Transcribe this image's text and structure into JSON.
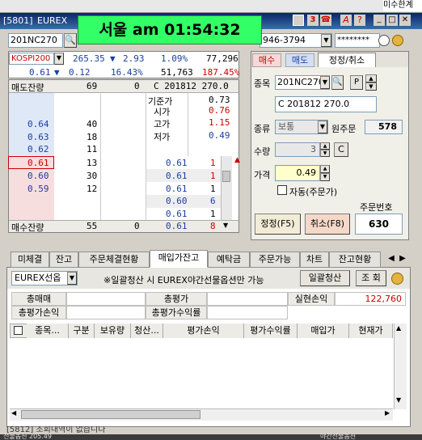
{
  "window": {
    "title_code": "[5801]",
    "title_text": "EUREX",
    "clock": "서울 am 01:54:32",
    "corner_label": "미수한계"
  },
  "left": {
    "code_value": "201NC270",
    "index_name": "KOSPI200",
    "index_price": "265.35",
    "index_change_arrow": "▼",
    "index_change": "2.93",
    "index_pct": "1.09%",
    "index_volume": "77,296",
    "row2_price": "0.61",
    "row2_arrow": "▼",
    "row2_change": "0.12",
    "row2_pct": "16.43%",
    "row2_volume": "51,763",
    "row2_ratio": "187.45%",
    "header_sell_label": "매도잔량",
    "header_sell_qty": "69",
    "header_zero": "0",
    "header_contract": "C 201812 270.0",
    "info": [
      {
        "label": "기준가",
        "value": "0.73"
      },
      {
        "label": "시가",
        "value": "0.76"
      },
      {
        "label": "고가",
        "value": "1.15"
      },
      {
        "label": "저가",
        "value": "0.49"
      }
    ],
    "asks": [
      {
        "price": "0.64",
        "qty": "40"
      },
      {
        "price": "0.63",
        "qty": "18"
      },
      {
        "price": "0.62",
        "qty": "11"
      }
    ],
    "bids": [
      {
        "price": "0.61",
        "qty": "13"
      },
      {
        "price": "0.60",
        "qty": "30"
      },
      {
        "price": "0.59",
        "qty": "12"
      }
    ],
    "ticks": [
      {
        "price": "0.61",
        "qty": "1"
      },
      {
        "price": "0.61",
        "qty": "1"
      },
      {
        "price": "0.61",
        "qty": "1"
      },
      {
        "price": "0.60",
        "qty": "6"
      },
      {
        "price": "0.61",
        "qty": "1"
      },
      {
        "price": "0.61",
        "qty": "8"
      }
    ],
    "footer_buy_label": "매수잔량",
    "footer_buy_qty": "55",
    "footer_zero": "0"
  },
  "right": {
    "account": "946-3794",
    "password_mask": "********",
    "tabs": [
      "매수",
      "매도",
      "정정/취소"
    ],
    "code_label": "종목",
    "code_value": "201NC270",
    "contract": "C 201812 270.0",
    "type_label": "종류",
    "type_value": "보통",
    "orig_order_label": "원주문",
    "orig_order_value": "578",
    "qty_label": "수량",
    "qty_value": "3",
    "qty_btn": "C",
    "price_label": "가격",
    "price_value": "0.49",
    "auto_label": "자동(주문가)",
    "order_no_label": "주문번호",
    "modify_btn": "정정(F5)",
    "cancel_btn": "취소(F8)",
    "order_no_value": "630"
  },
  "bottom": {
    "tabs": [
      "미체결",
      "잔고",
      "주문체결현황",
      "매입가잔고",
      "예탁금",
      "주문가능",
      "차트",
      "잔고현황"
    ],
    "active_tab": 3,
    "market_select": "EUREX선옵",
    "notice": "※일괄청산 시 EUREX야간선물옵션만 가능",
    "liquidate_btn": "일괄청산",
    "query_btn": "조 회",
    "sum_labels": {
      "total_buy": "총매매",
      "total_eval": "총평가",
      "realized": "실현손익",
      "total_eval_pl": "총평가손익",
      "total_eval_rate": "총평가수익률"
    },
    "realized_value": "122,760",
    "columns": [
      "종목...",
      "구분",
      "보유량",
      "청산...",
      "평가손익",
      "평가수익률",
      "매입가",
      "현재가"
    ],
    "status": "[5812] 조회내역이 없습니다",
    "footer_left": "선물옵션 205.49",
    "footer_right": "야간선물옵션"
  },
  "colors": {
    "clock_bg": "#33ff66",
    "ask_bg": "#dfe8f7",
    "bid_bg": "#f7dede",
    "price_highlight": "#ffffcc"
  }
}
